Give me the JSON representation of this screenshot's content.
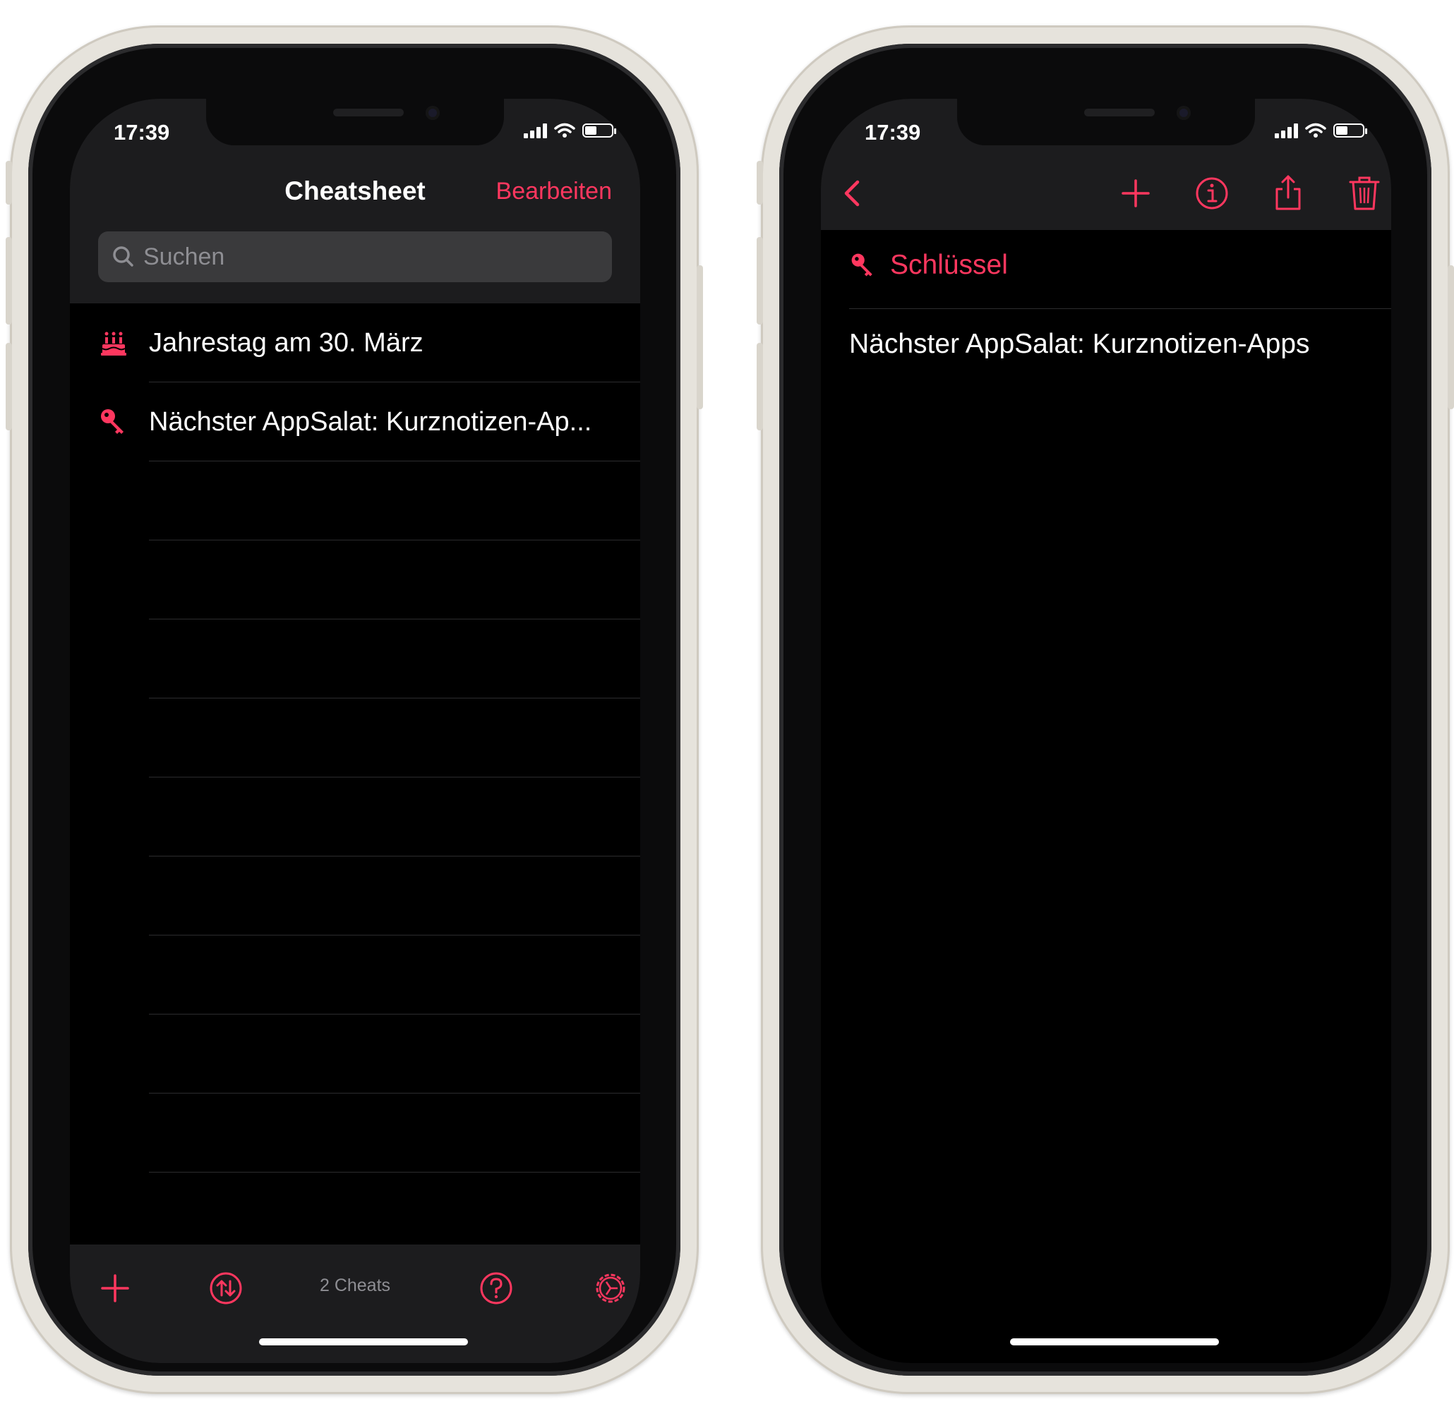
{
  "theme": {
    "accent": "#ff375f",
    "background": "#000000",
    "bar": "#1c1c1e",
    "secondary_text": "#8e8e93"
  },
  "list_screen": {
    "status": {
      "time": "17:39"
    },
    "nav": {
      "title": "Cheatsheet",
      "edit_label": "Bearbeiten"
    },
    "search": {
      "placeholder": "Suchen"
    },
    "items": [
      {
        "icon": "birthday-cake-icon",
        "label": "Jahrestag am 30. März"
      },
      {
        "icon": "key-icon",
        "label": "Nächster AppSalat: Kurznotizen-Ap..."
      }
    ],
    "toolbar": {
      "count_label": "2 Cheats",
      "icons": [
        "plus-icon",
        "sort-icon",
        "help-icon",
        "settings-icon"
      ]
    }
  },
  "detail_screen": {
    "status": {
      "time": "17:39"
    },
    "nav_icons": [
      "back-chevron-icon",
      "plus-icon",
      "info-icon",
      "share-icon",
      "trash-icon"
    ],
    "category": {
      "icon": "key-icon",
      "label": "Schlüssel"
    },
    "body": "Nächster AppSalat: Kurznotizen-Apps"
  }
}
